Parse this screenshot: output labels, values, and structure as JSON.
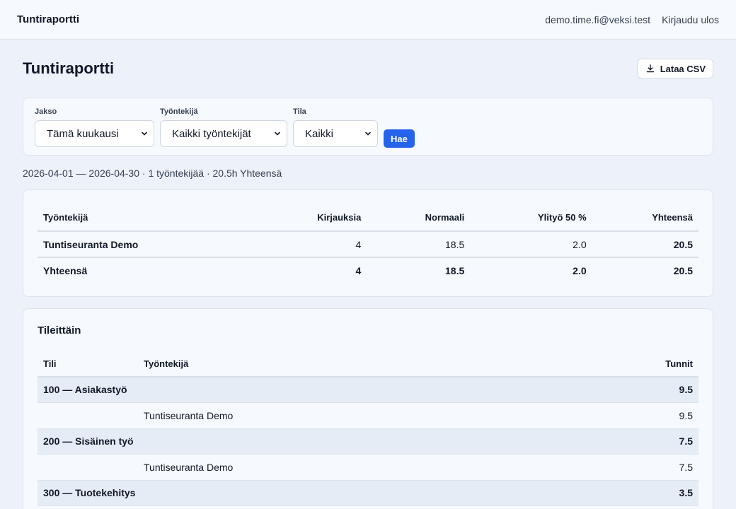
{
  "header": {
    "brand": "Tuntiraportti",
    "user_email": "demo.time.fi@veksi.test",
    "logout_label": "Kirjaudu ulos"
  },
  "page": {
    "title": "Tuntiraportti",
    "csv_label": "Lataa CSV"
  },
  "filters": {
    "period_label": "Jakso",
    "period_value": "Tämä kuukausi",
    "employee_label": "Työntekijä",
    "employee_value": "Kaikki työntekijät",
    "status_label": "Tila",
    "status_value": "Kaikki",
    "submit_label": "Hae"
  },
  "summary": "2026-04-01 — 2026-04-30 · 1 työntekijää · 20.5h Yhteensä",
  "employee_table": {
    "headers": [
      "Työntekijä",
      "Kirjauksia",
      "Normaali",
      "Ylityö 50 %",
      "Yhteensä"
    ],
    "rows": [
      [
        "Tuntiseuranta Demo",
        "4",
        "18.5",
        "2.0",
        "20.5"
      ]
    ],
    "total": [
      "Yhteensä",
      "4",
      "18.5",
      "2.0",
      "20.5"
    ]
  },
  "accounts": {
    "title": "Tileittäin",
    "headers": [
      "Tili",
      "Työntekijä",
      "Tunnit"
    ],
    "groups": [
      {
        "account": "100 — Asiakastyö",
        "hours": "9.5",
        "employee": "Tuntiseuranta Demo",
        "employee_hours": "9.5"
      },
      {
        "account": "200 — Sisäinen työ",
        "hours": "7.5",
        "employee": "Tuntiseuranta Demo",
        "employee_hours": "7.5"
      },
      {
        "account": "300 — Tuotekehitys",
        "hours": "3.5"
      }
    ]
  },
  "colors": {
    "accent": "#2563eb",
    "background": "#ecf1fa",
    "card": "#f6f9fd"
  },
  "icons": {
    "download": "download-icon",
    "chevron": "chevron-down-icon"
  }
}
